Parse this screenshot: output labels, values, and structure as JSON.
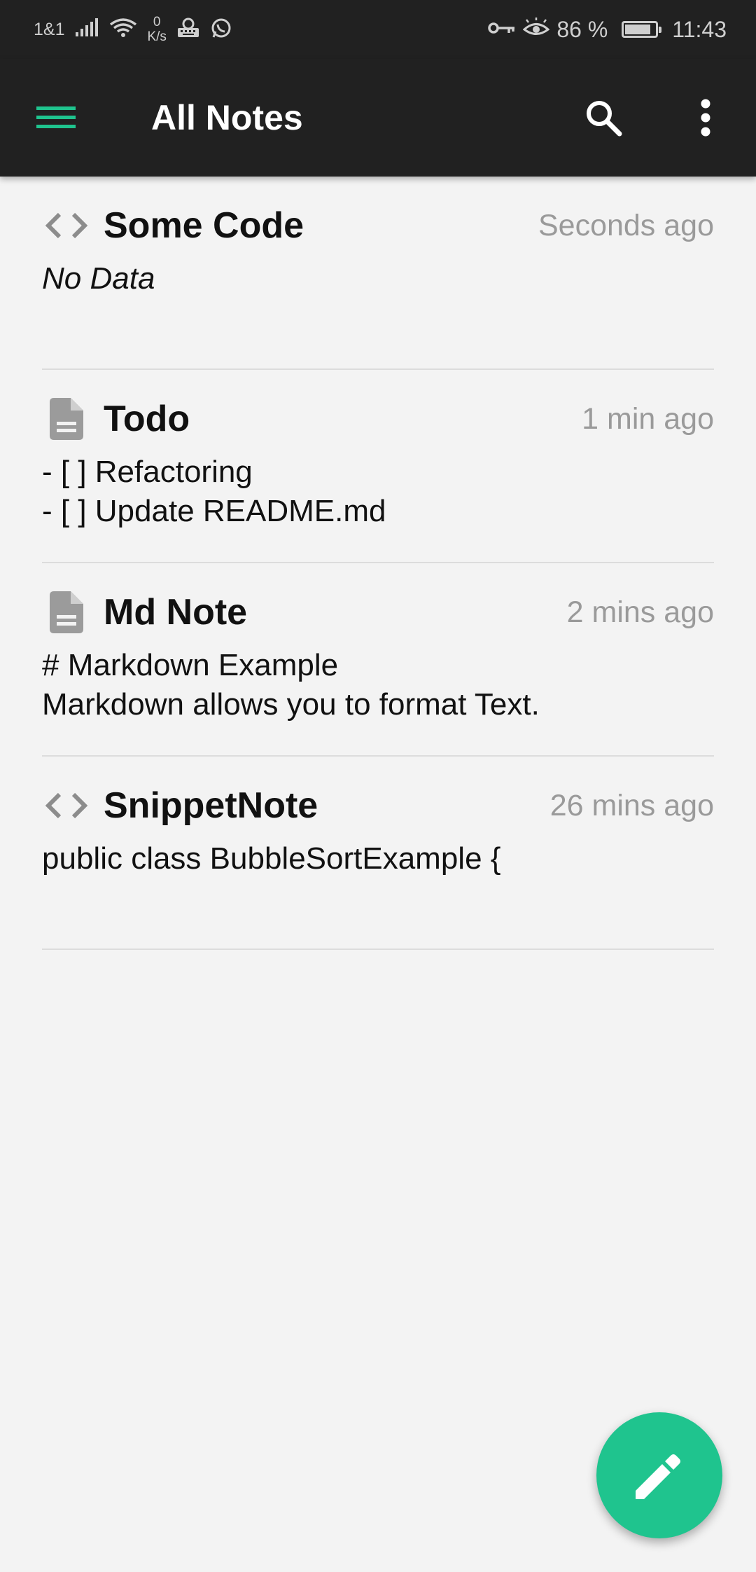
{
  "status_bar": {
    "carrier": "1&1",
    "net_speed_value": "0",
    "net_speed_unit": "K/s",
    "battery_percent_text": "86 %",
    "battery_level": 0.86,
    "time": "11:43",
    "icons": [
      "signal-icon",
      "wifi-icon",
      "keyboard-icon",
      "whatsapp-icon",
      "vpn-key-icon",
      "eye-comfort-icon",
      "battery-icon"
    ]
  },
  "toolbar": {
    "title": "All Notes",
    "menu_icon": "hamburger-menu-icon",
    "search_icon": "search-icon",
    "more_icon": "more-vertical-icon",
    "accent_color": "#1fc48e"
  },
  "notes": [
    {
      "type": "snippet",
      "icon": "code-icon",
      "title": "Some Code",
      "time": "Seconds ago",
      "preview": "No Data",
      "preview_italic": true
    },
    {
      "type": "markdown",
      "icon": "document-icon",
      "title": "Todo",
      "time": "1 min ago",
      "preview": "- [ ] Refactoring\n- [ ] Update README.md",
      "preview_italic": false
    },
    {
      "type": "markdown",
      "icon": "document-icon",
      "title": "Md Note",
      "time": "2 mins ago",
      "preview": "# Markdown Example\nMarkdown allows you to format Text.",
      "preview_italic": false
    },
    {
      "type": "snippet",
      "icon": "code-icon",
      "title": "SnippetNote",
      "time": "26 mins ago",
      "preview": "public class BubbleSortExample {",
      "preview_italic": false
    }
  ],
  "fab": {
    "icon": "pencil-icon",
    "color": "#1fc48e"
  }
}
